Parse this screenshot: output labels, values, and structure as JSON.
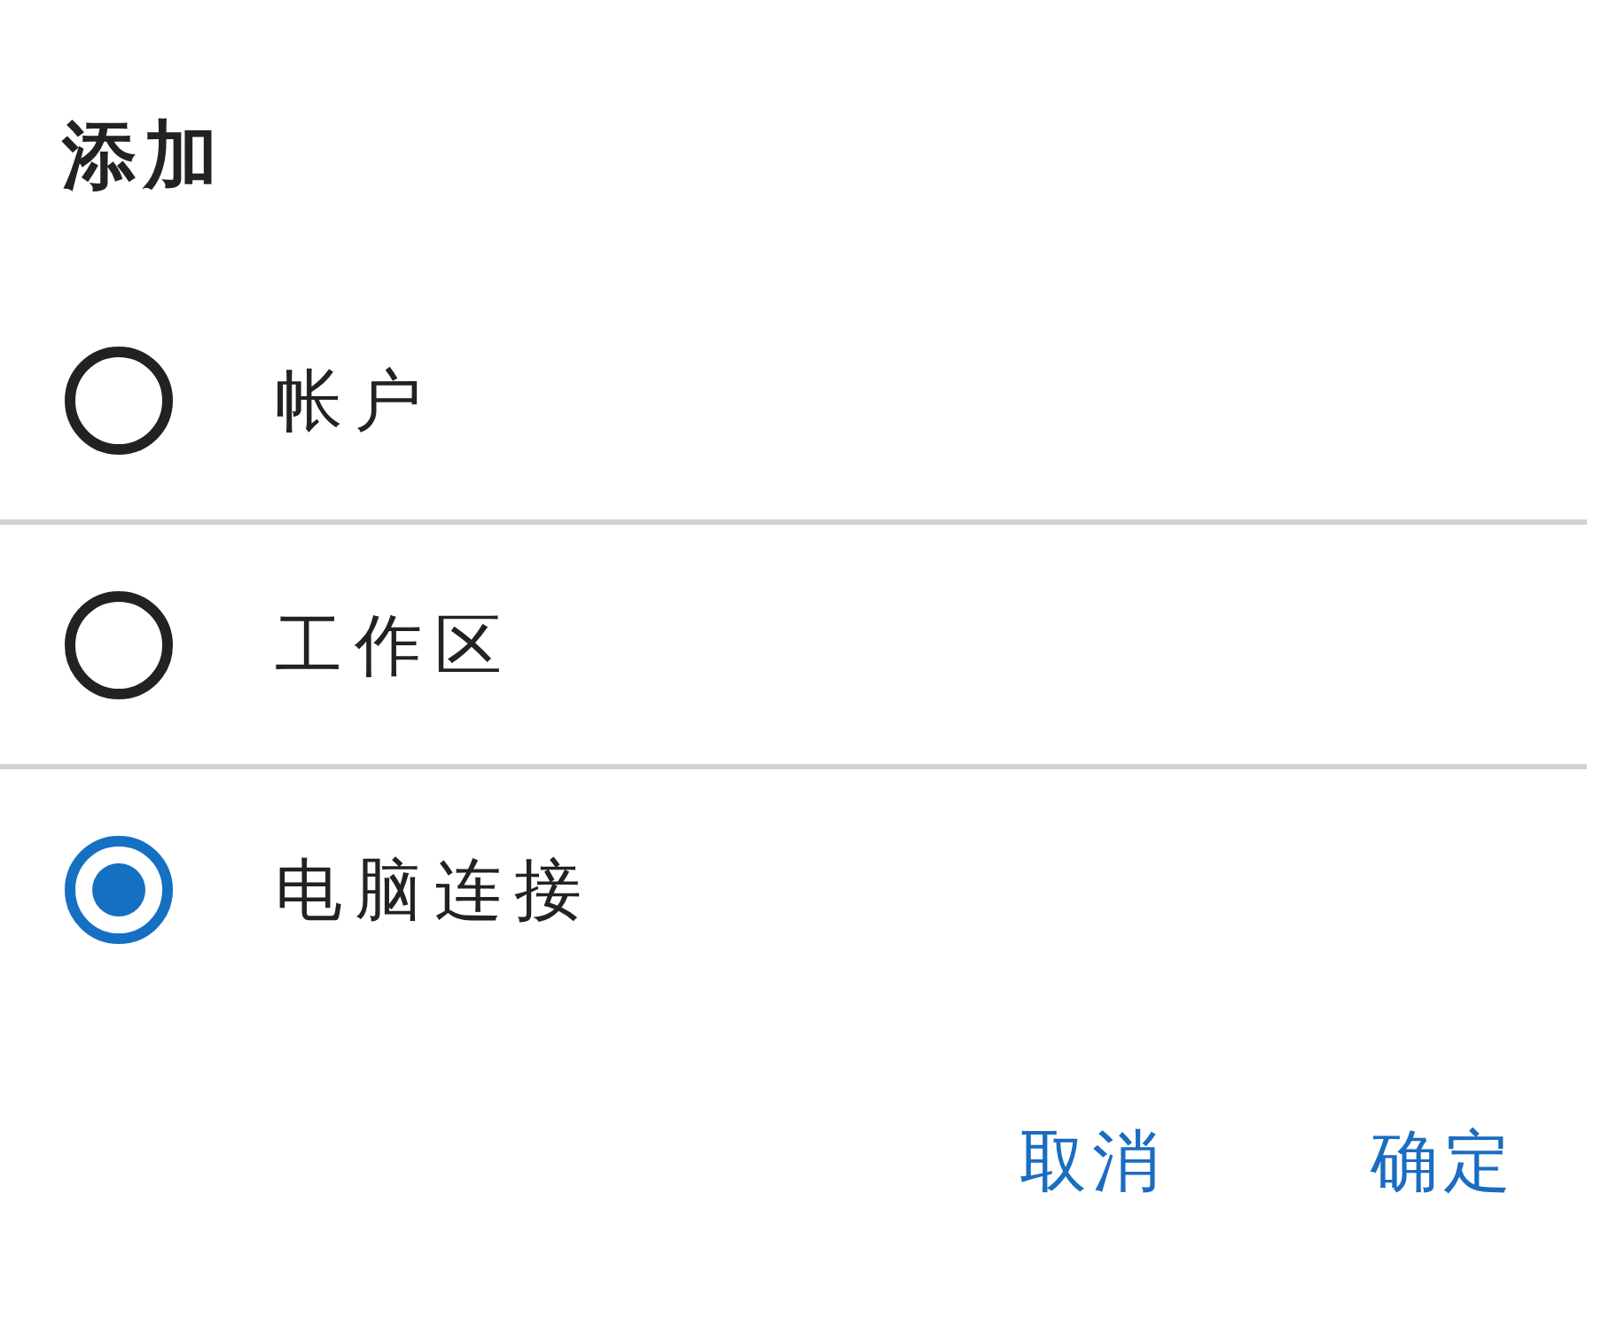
{
  "dialog": {
    "title": "添加",
    "options": [
      {
        "label": "帐户",
        "selected": false
      },
      {
        "label": "工作区",
        "selected": false
      },
      {
        "label": "电脑连接",
        "selected": true
      }
    ],
    "buttons": [
      {
        "label": "取消"
      },
      {
        "label": "确定"
      }
    ]
  }
}
